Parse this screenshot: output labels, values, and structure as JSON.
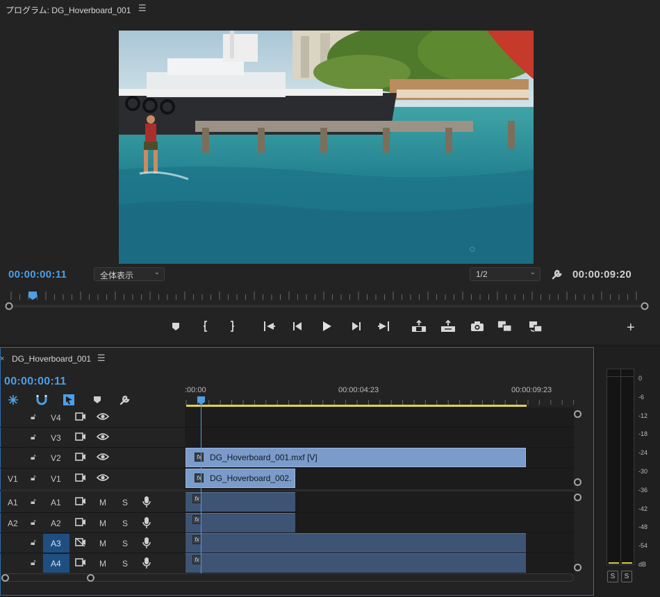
{
  "program_monitor": {
    "title": "プログラム: DG_Hoverboard_001",
    "menu_icon": "hamburger-icon",
    "current_timecode": "00:00:00:11",
    "duration_timecode": "00:00:09:20",
    "zoom_select": "全体表示",
    "resolution_select": "1/2",
    "transport_icons": [
      "add-marker-icon",
      "mark-in-icon",
      "mark-out-icon",
      "go-to-in-icon",
      "step-back-icon",
      "play-icon",
      "step-forward-icon",
      "go-to-out-icon",
      "lift-icon",
      "extract-icon",
      "export-frame-icon",
      "comparison-view-icon",
      "proxy-toggle-icon",
      "add-button-icon"
    ]
  },
  "timeline": {
    "title": "DG_Hoverboard_001",
    "close_glyph": "×",
    "menu_icon": "hamburger-icon",
    "timecode": "00:00:00:11",
    "ruler_labels": [
      ":00:00",
      "00:00:04:23",
      "00:00:09:23"
    ],
    "tools": [
      "nest-sequence-icon",
      "snap-icon",
      "linked-selection-icon",
      "add-marker-icon",
      "settings-wrench-icon"
    ],
    "video_tracks": [
      {
        "source": "",
        "name": "V4"
      },
      {
        "source": "",
        "name": "V3"
      },
      {
        "source": "",
        "name": "V2"
      },
      {
        "source": "V1",
        "name": "V1"
      }
    ],
    "audio_tracks": [
      {
        "source": "A1",
        "name": "A1",
        "mute": "M",
        "solo": "S"
      },
      {
        "source": "A2",
        "name": "A2",
        "mute": "M",
        "solo": "S"
      },
      {
        "source": "",
        "name": "A3",
        "mute": "M",
        "solo": "S"
      },
      {
        "source": "",
        "name": "A4",
        "mute": "M",
        "solo": "S"
      }
    ],
    "clips": {
      "v2_clip": "DG_Hoverboard_001.mxf [V]",
      "v1_clip": "DG_Hoverboard_002.",
      "fx_badge": "fx"
    }
  },
  "audio_meter": {
    "db_scale": [
      "0",
      "-6",
      "-12",
      "-18",
      "-24",
      "-30",
      "-36",
      "-42",
      "-48",
      "-54",
      "dB"
    ],
    "solo_labels": [
      "S",
      "S"
    ]
  },
  "colors": {
    "accent_blue": "#4d9fe6",
    "work_area_yellow": "#e0d24a",
    "video_clip": "#7b9ccb",
    "audio_clip": "#3e5475"
  }
}
